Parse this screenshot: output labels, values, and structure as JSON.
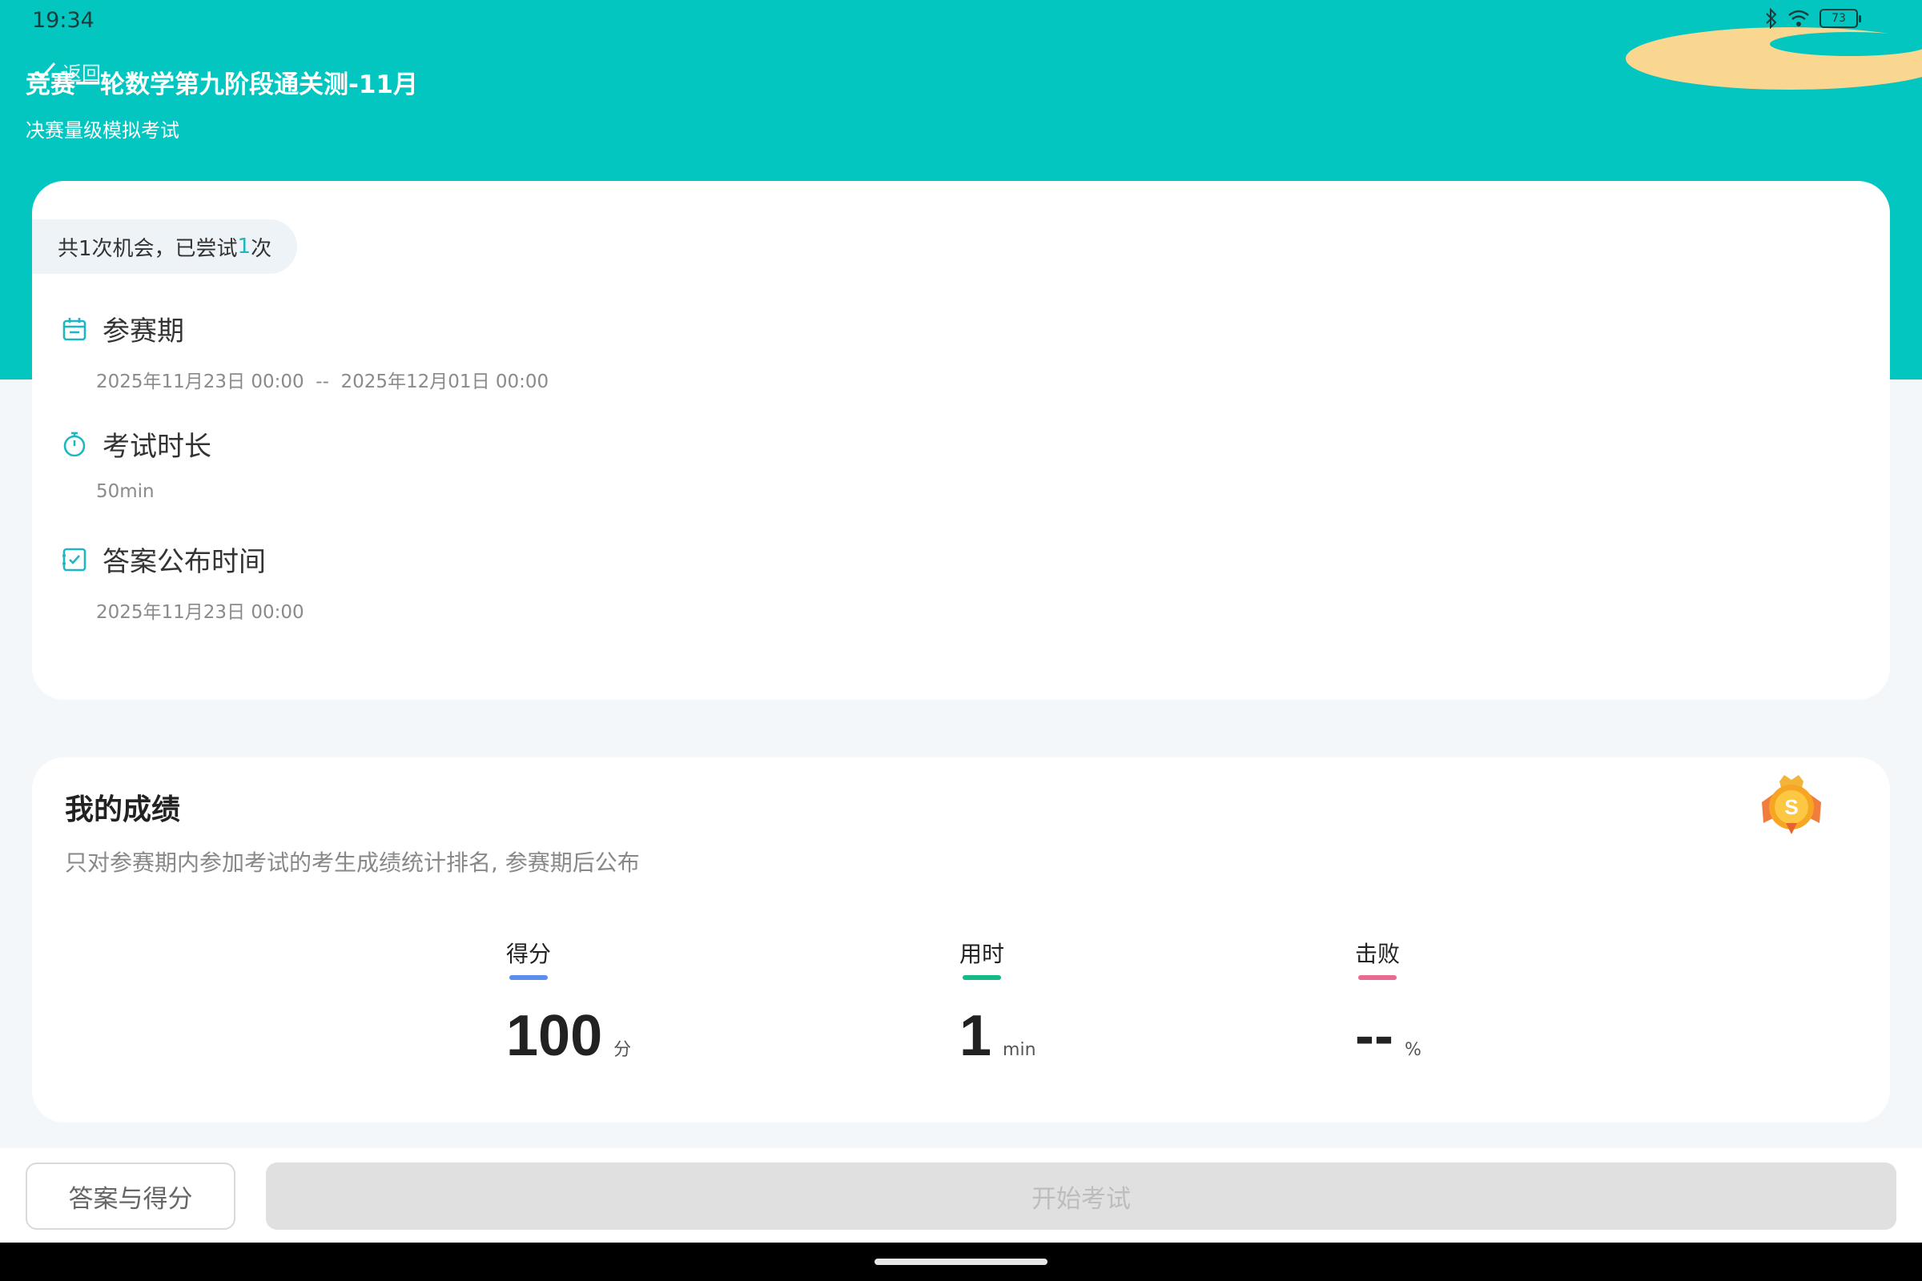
{
  "status_bar": {
    "time": "19:34",
    "battery": "73"
  },
  "header": {
    "back_label": "返回",
    "title": "竞赛一轮数学第九阶段通关测-11月",
    "subtitle": "决赛量级模拟考试"
  },
  "info": {
    "attempts_prefix": "共1次机会，已尝试",
    "attempts_count": "1",
    "attempts_suffix": "次",
    "period": {
      "label": "参赛期",
      "value": "2025年11月23日 00:00  --  2025年12月01日 00:00",
      "icon": "calendar-icon"
    },
    "duration": {
      "label": "考试时长",
      "value": "50min",
      "icon": "stopwatch-icon"
    },
    "answer_release": {
      "label": "答案公布时间",
      "value": "2025年11月23日 00:00",
      "icon": "checklist-icon"
    }
  },
  "score": {
    "title": "我的成绩",
    "description": "只对参赛期内参加考试的考生成绩统计排名, 参赛期后公布",
    "medal_letter": "S",
    "stats": [
      {
        "label": "得分",
        "value": "100",
        "unit": "分",
        "bar_color": "#5b8def"
      },
      {
        "label": "用时",
        "value": "1",
        "unit": "min",
        "bar_color": "#16b887"
      },
      {
        "label": "击败",
        "value": "--",
        "unit": "%",
        "bar_color": "#e96a8f"
      }
    ]
  },
  "actions": {
    "answers_label": "答案与得分",
    "start_label": "开始考试"
  },
  "colors": {
    "primary": "#03c6c0",
    "accent_text": "#1db7c2"
  }
}
